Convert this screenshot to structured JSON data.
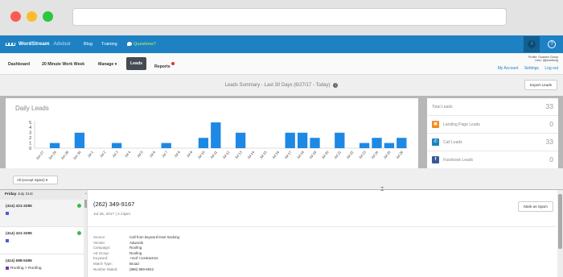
{
  "browser": {},
  "nav": {
    "brand": "WordStream",
    "brand_sub": "Advisor",
    "links": [
      "Blog",
      "Training"
    ],
    "questions": "Questions?"
  },
  "subnav": {
    "items": [
      "Dashboard",
      "20 Minute Work Week",
      "Manage ▾",
      "Leads",
      "Reports"
    ],
    "profile_line1": "Profile: Goarsen Group",
    "profile_line2": "User: @jsmidborg",
    "account_links": [
      "My Account",
      "Settings",
      "Log out"
    ]
  },
  "summary": {
    "title": "Leads Summary - Last 30 Days (6/27/17 - Today)",
    "export_label": "Export Leads"
  },
  "chart_data": {
    "type": "bar",
    "title": "Daily Leads",
    "xlabel": "",
    "ylabel": "",
    "ylim": [
      0,
      5
    ],
    "yticks": [
      0,
      1,
      2,
      3,
      4,
      5
    ],
    "categories": [
      "Jun 27",
      "Jun 28",
      "Jun 29",
      "Jun 30",
      "Jul 1",
      "Jul 2",
      "Jul 3",
      "Jul 4",
      "Jul 5",
      "Jul 6",
      "Jul 7",
      "Jul 8",
      "Jul 9",
      "Jul 10",
      "Jul 11",
      "Jul 12",
      "Jul 13",
      "Jul 14",
      "Jul 15",
      "Jul 16",
      "Jul 17",
      "Jul 18",
      "Jul 19",
      "Jul 20",
      "Jul 21",
      "Jul 22",
      "Jul 23",
      "Jul 24",
      "Jul 25",
      "Jul 26"
    ],
    "values": [
      0,
      1,
      0,
      3,
      0,
      0,
      1,
      0,
      0,
      0,
      1,
      0,
      0,
      2,
      5,
      0,
      3,
      0,
      0,
      0,
      3,
      3,
      2,
      0,
      3,
      0,
      1,
      2,
      1,
      2
    ],
    "bar_color": "#1e88e5",
    "grid": false
  },
  "stats": [
    {
      "label": "Total Leads",
      "value": "33",
      "icon": ""
    },
    {
      "label": "Landing Page Leads",
      "value": "0",
      "icon": "landing-page-icon",
      "color": "#f28c1e"
    },
    {
      "label": "Call Leads",
      "value": "33",
      "icon": "phone-icon",
      "color": "#1d81c3"
    },
    {
      "label": "Facebook Leads",
      "value": "0",
      "icon": "facebook-icon",
      "color": "#3b5998"
    }
  ],
  "filter": {
    "value": "All (except Spam)"
  },
  "leads": {
    "date_prefix": "Friday",
    "date": "July 21st",
    "items": [
      {
        "phone": "(414) 421-3285",
        "tag": ""
      },
      {
        "phone": "(414) 421-3285",
        "tag": ""
      },
      {
        "phone": "(414) 688-5486",
        "tag": "Roofing > Roofing"
      }
    ]
  },
  "detail": {
    "phone": "(262) 349-9167",
    "date": "Jul 26, 2017 | 2:13pm",
    "spam_label": "Mark as Spam",
    "fields": [
      {
        "k": "Source:",
        "v": "Call from keyword level tracking"
      },
      {
        "k": "Vendor:",
        "v": "Adwords"
      },
      {
        "k": "Campaign:",
        "v": "Roofing"
      },
      {
        "k": "Ad Group:",
        "v": "Roofing"
      },
      {
        "k": "Keyword:",
        "v": "+roof +contractors"
      },
      {
        "k": "Match Type:",
        "v": "Broad"
      },
      {
        "k": "Number Dialed:",
        "v": "(866) 869-9042"
      }
    ]
  }
}
